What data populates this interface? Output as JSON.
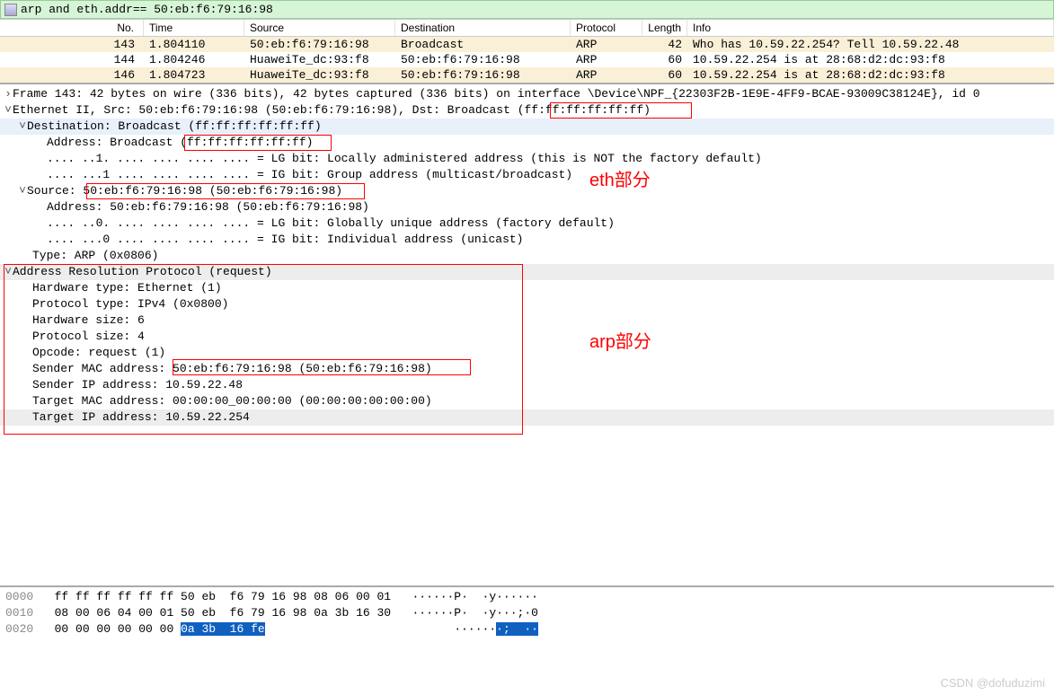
{
  "filter": {
    "text": "arp and eth.addr== 50:eb:f6:79:16:98"
  },
  "columns": {
    "no": "No.",
    "time": "Time",
    "src": "Source",
    "dst": "Destination",
    "proto": "Protocol",
    "len": "Length",
    "info": "Info"
  },
  "packets": [
    {
      "no": "143",
      "time": "1.804110",
      "src": "50:eb:f6:79:16:98",
      "dst": "Broadcast",
      "proto": "ARP",
      "len": "42",
      "info": "Who has 10.59.22.254? Tell 10.59.22.48"
    },
    {
      "no": "144",
      "time": "1.804246",
      "src": "HuaweiTe_dc:93:f8",
      "dst": "50:eb:f6:79:16:98",
      "proto": "ARP",
      "len": "60",
      "info": "10.59.22.254 is at 28:68:d2:dc:93:f8"
    },
    {
      "no": "146",
      "time": "1.804723",
      "src": "HuaweiTe_dc:93:f8",
      "dst": "50:eb:f6:79:16:98",
      "proto": "ARP",
      "len": "60",
      "info": "10.59.22.254 is at 28:68:d2:dc:93:f8"
    }
  ],
  "details": {
    "frame": "Frame 143: 42 bytes on wire (336 bits), 42 bytes captured (336 bits) on interface \\Device\\NPF_{22303F2B-1E9E-4FF9-BCAE-93009C38124E}, id 0",
    "eth": "Ethernet II, Src: 50:eb:f6:79:16:98 (50:eb:f6:79:16:98), Dst: Broadcast (ff:ff:ff:ff:ff:ff)",
    "dst": "Destination: Broadcast (ff:ff:ff:ff:ff:ff)",
    "dst_addr": "Address: Broadcast (ff:ff:ff:ff:ff:ff)",
    "dst_lg": ".... ..1. .... .... .... .... = LG bit: Locally administered address (this is NOT the factory default)",
    "dst_ig": ".... ...1 .... .... .... .... = IG bit: Group address (multicast/broadcast)",
    "src": "Source: 50:eb:f6:79:16:98 (50:eb:f6:79:16:98)",
    "src_addr": "Address: 50:eb:f6:79:16:98 (50:eb:f6:79:16:98)",
    "src_lg": ".... ..0. .... .... .... .... = LG bit: Globally unique address (factory default)",
    "src_ig": ".... ...0 .... .... .... .... = IG bit: Individual address (unicast)",
    "type": "Type: ARP (0x0806)",
    "arp": "Address Resolution Protocol (request)",
    "hw_type": "Hardware type: Ethernet (1)",
    "proto_type": "Protocol type: IPv4 (0x0800)",
    "hw_size": "Hardware size: 6",
    "proto_size": "Protocol size: 4",
    "opcode": "Opcode: request (1)",
    "sender_mac": "Sender MAC address: 50:eb:f6:79:16:98 (50:eb:f6:79:16:98)",
    "sender_ip": "Sender IP address: 10.59.22.48",
    "target_mac": "Target MAC address: 00:00:00_00:00:00 (00:00:00:00:00:00)",
    "target_ip": "Target IP address: 10.59.22.254"
  },
  "anno": {
    "eth": "eth部分",
    "arp": "arp部分"
  },
  "hex": {
    "r0": {
      "off": "0000",
      "b": "ff ff ff ff ff ff 50 eb  f6 79 16 98 08 06 00 01",
      "a": "······P·  ·y······"
    },
    "r1": {
      "off": "0010",
      "b": "08 00 06 04 00 01 50 eb  f6 79 16 98 0a 3b 16 30",
      "a": "······P·  ·y···;·0"
    },
    "r2": {
      "off": "0020",
      "b1": "00 00 00 00 00 00 ",
      "bsel": "0a 3b  16 fe",
      "a1": "······",
      "asel": "·;  ··"
    }
  },
  "watermark": "CSDN @dofuduzimi"
}
